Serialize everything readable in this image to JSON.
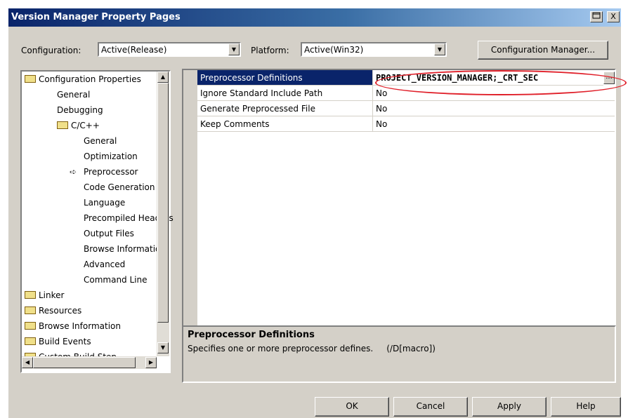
{
  "window": {
    "title": "Version Manager Property Pages",
    "close_label": "X",
    "help_icon": "question-icon"
  },
  "toolbar": {
    "configuration_label": "Configuration:",
    "configuration_value": "Active(Release)",
    "platform_label": "Platform:",
    "platform_value": "Active(Win32)",
    "config_manager_button": "Configuration Manager..."
  },
  "tree": {
    "items": [
      {
        "label": "Configuration Properties",
        "indent": 0,
        "icon": "open-folder-icon"
      },
      {
        "label": "General",
        "indent": 1,
        "icon": ""
      },
      {
        "label": "Debugging",
        "indent": 1,
        "icon": ""
      },
      {
        "label": "C/C++",
        "indent": 1,
        "icon": "open-folder-icon"
      },
      {
        "label": "General",
        "indent": 2,
        "icon": ""
      },
      {
        "label": "Optimization",
        "indent": 2,
        "icon": ""
      },
      {
        "label": "Preprocessor",
        "indent": 2,
        "icon": "arrow-right-icon"
      },
      {
        "label": "Code Generation",
        "indent": 2,
        "icon": ""
      },
      {
        "label": "Language",
        "indent": 2,
        "icon": ""
      },
      {
        "label": "Precompiled Headers",
        "indent": 2,
        "icon": ""
      },
      {
        "label": "Output Files",
        "indent": 2,
        "icon": ""
      },
      {
        "label": "Browse Information",
        "indent": 2,
        "icon": ""
      },
      {
        "label": "Advanced",
        "indent": 2,
        "icon": ""
      },
      {
        "label": "Command Line",
        "indent": 2,
        "icon": ""
      },
      {
        "label": "Linker",
        "indent": 0,
        "icon": "folder-icon"
      },
      {
        "label": "Resources",
        "indent": 0,
        "icon": "folder-icon"
      },
      {
        "label": "Browse Information",
        "indent": 0,
        "icon": "folder-icon"
      },
      {
        "label": "Build Events",
        "indent": 0,
        "icon": "folder-icon"
      },
      {
        "label": "Custom Build Step",
        "indent": 0,
        "icon": "folder-icon"
      }
    ]
  },
  "grid": {
    "rows": [
      {
        "name": "Preprocessor Definitions",
        "value": "PROJECT_VERSION_MANAGER;_CRT_SEC",
        "selected": true
      },
      {
        "name": "Ignore Standard Include Path",
        "value": "No",
        "selected": false
      },
      {
        "name": "Generate Preprocessed File",
        "value": "No",
        "selected": false
      },
      {
        "name": "Keep Comments",
        "value": "No",
        "selected": false
      }
    ],
    "ellipsis": "..."
  },
  "description": {
    "title": "Preprocessor Definitions",
    "text": "Specifies one or more preprocessor defines.     (/D[macro])"
  },
  "buttons": {
    "ok": "OK",
    "cancel": "Cancel",
    "apply": "Apply",
    "help": "Help"
  },
  "colors": {
    "selection": "#0a246a",
    "annotation": "#e0202a"
  }
}
